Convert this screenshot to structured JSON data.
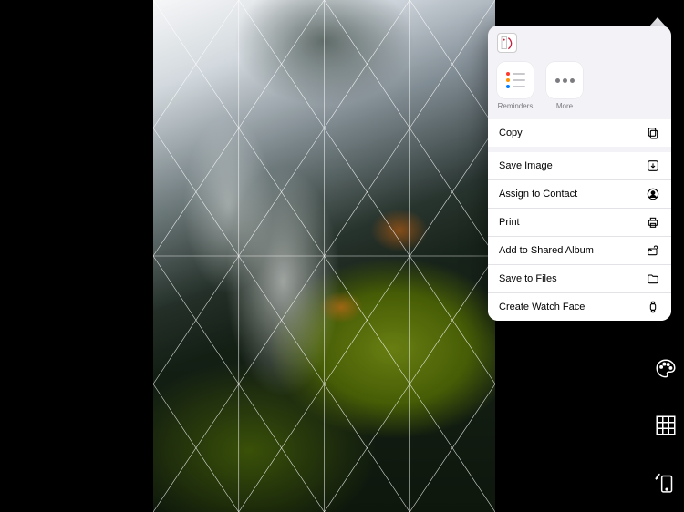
{
  "share": {
    "items": [
      {
        "id": "reminders",
        "label": "Reminders"
      },
      {
        "id": "more",
        "label": "More"
      }
    ]
  },
  "actions": {
    "copy": "Copy",
    "save_image": "Save Image",
    "assign_contact": "Assign to Contact",
    "print": "Print",
    "add_shared_album": "Add to Shared Album",
    "save_to_files": "Save to Files",
    "create_watch_face": "Create Watch Face"
  },
  "toolbar": {
    "palette": "palette",
    "grid": "grid",
    "rotate": "rotate-device"
  }
}
